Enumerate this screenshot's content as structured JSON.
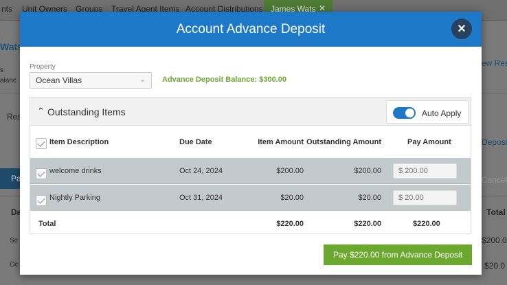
{
  "background": {
    "tabs": [
      "nts",
      "Unit Owners",
      "Groups",
      "Travel Agent Items",
      "Account Distributions"
    ],
    "active_tab": "James Wats",
    "active_tab_close": "✕",
    "left_fragments": [
      "Wats",
      "s",
      "alanc",
      "Res",
      "Pa",
      "Da",
      "Se",
      "Oc"
    ],
    "right_fragments": [
      "ew Rese",
      "Deposit",
      "Cancel",
      "Total",
      "$200.0",
      "$20.0"
    ]
  },
  "modal": {
    "title": "Account Advance Deposit",
    "close_icon": "×",
    "property_label": "Property",
    "property_value": "Ocean Villas",
    "balance_text": "Advance Deposit Balance: $300.00",
    "panel_title": "Outstanding Items",
    "auto_apply_label": "Auto Apply",
    "auto_apply_on": true,
    "columns": {
      "description": "Item Description",
      "due_date": "Due Date",
      "item_amount": "Item Amount",
      "outstanding_amount": "Outstanding Amount",
      "pay_amount": "Pay Amount"
    },
    "rows": [
      {
        "checked": true,
        "description": "welcome drinks",
        "due_date": "Oct 24, 2024",
        "item_amount": "$200.00",
        "outstanding_amount": "$200.00",
        "pay_placeholder": "$ 200.00"
      },
      {
        "checked": true,
        "description": "Nightly Parking",
        "due_date": "Oct 31, 2024",
        "item_amount": "$20.00",
        "outstanding_amount": "$20.00",
        "pay_placeholder": "$ 20.00"
      }
    ],
    "total": {
      "label": "Total",
      "item_amount": "$220.00",
      "outstanding_amount": "$220.00",
      "pay_amount": "$220.00"
    },
    "pay_button": "Pay $220.00 from Advance Deposit"
  },
  "colors": {
    "header": "#1e78c8",
    "accent_green": "#6aa82e",
    "row_highlight": "#c3cacd"
  }
}
